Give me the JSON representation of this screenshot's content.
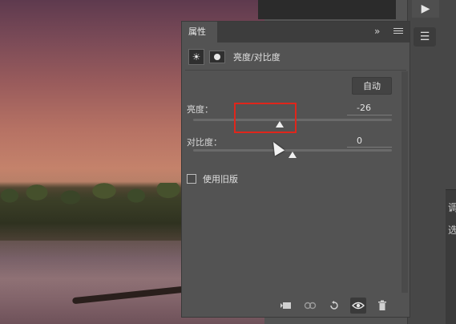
{
  "panel": {
    "tab_label": "属性",
    "collapse_label": "»",
    "header_title": "亮度/对比度",
    "auto_label": "自动",
    "brightness": {
      "label": "亮度：",
      "value": "-26",
      "level": 0.435
    },
    "contrast": {
      "label": "对比度：",
      "value": "0",
      "level": 0.5
    },
    "legacy_label": "使用旧版"
  },
  "toolbar": {
    "play_symbol": "▶"
  },
  "icons": {
    "adjustment": "sun-adjustment-icon",
    "mask": "mask-icon",
    "clip": "clip-to-layer-icon",
    "view_previous": "view-previous-icon",
    "reset": "reset-icon",
    "visibility": "eye-icon",
    "delete": "trash-icon"
  },
  "right_edge": {
    "char1": "调",
    "char2": "选"
  },
  "colors": {
    "highlight": "#e0261b",
    "panel_bg": "#535353"
  }
}
